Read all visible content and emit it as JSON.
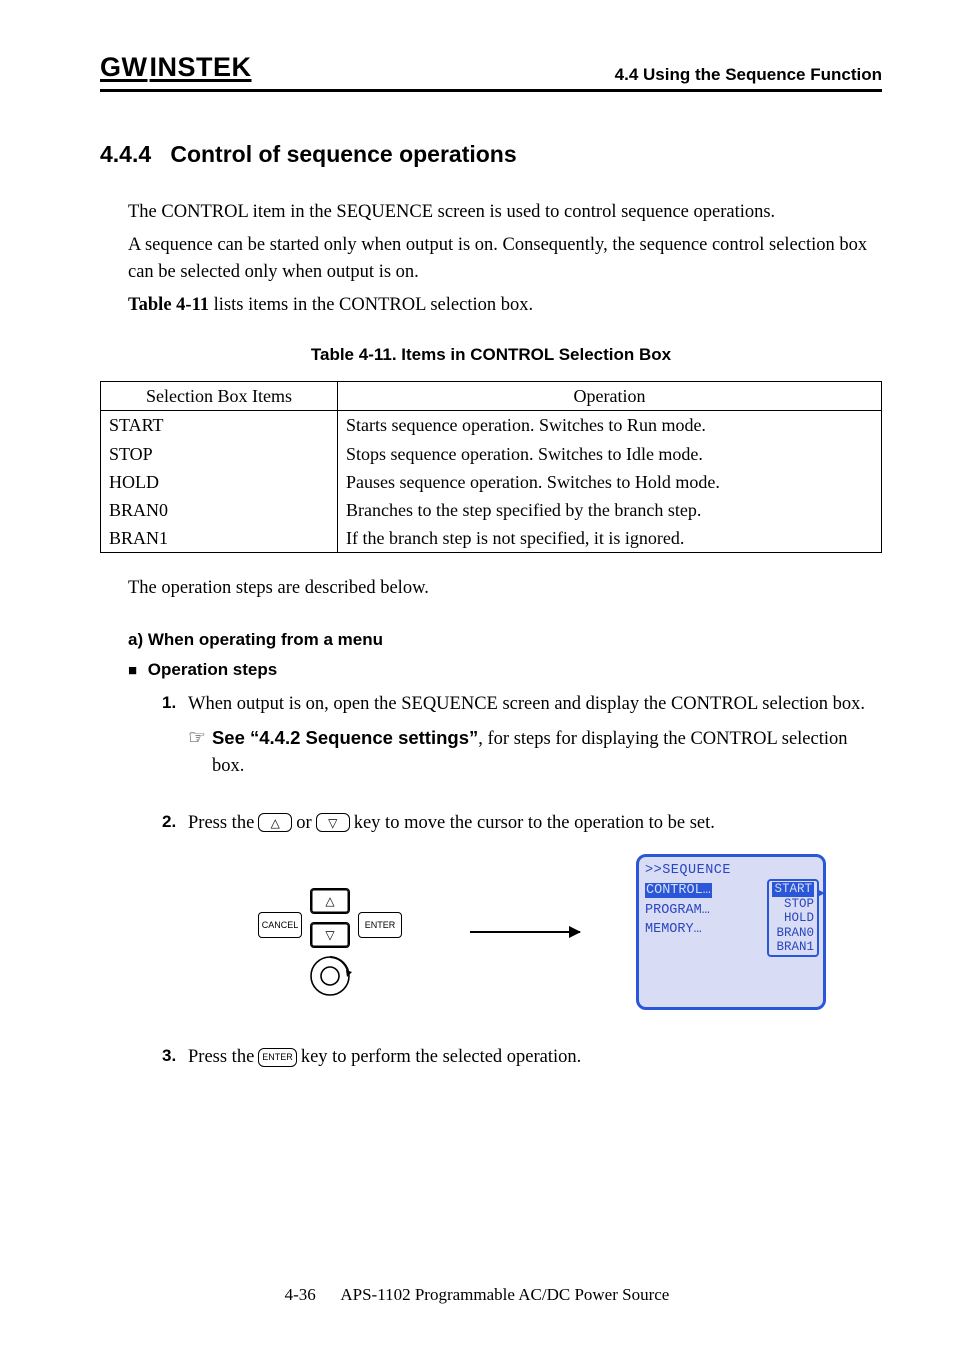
{
  "header": {
    "brand_parts": [
      "G",
      "W",
      "INSTEK"
    ],
    "section_label": "4.4 Using the Sequence Function"
  },
  "title": {
    "number": "4.4.4",
    "text": "Control of sequence operations"
  },
  "intro": {
    "p1": "The CONTROL item in the SEQUENCE screen is used to control sequence operations.",
    "p2": "A sequence can be started only when output is on.  Consequently, the sequence control selection box can be selected only when output is on.",
    "p3_prefix": "Table 4-11",
    "p3_rest": " lists items in the CONTROL selection box."
  },
  "table": {
    "caption": "Table 4-11.  Items in CONTROL Selection Box",
    "head": [
      "Selection Box Items",
      "Operation"
    ],
    "rows": [
      [
        "START",
        "Starts sequence operation.  Switches to Run mode."
      ],
      [
        "STOP",
        "Stops sequence operation.  Switches to Idle mode."
      ],
      [
        "HOLD",
        "Pauses sequence operation.  Switches to Hold mode."
      ],
      [
        "BRAN0",
        "Branches to the step specified by the branch step."
      ],
      [
        "BRAN1",
        "If the branch step is not specified, it is ignored."
      ]
    ]
  },
  "after_table": "The operation steps are described below.",
  "sub_a": "a)  When operating from a menu",
  "op_steps_label": "Operation steps",
  "steps": {
    "s1": {
      "num": "1.",
      "text": "When output is on, open the SEQUENCE screen and display the CONTROL selection box.",
      "see_bold": "See “4.4.2  Sequence settings”",
      "see_rest": ", for steps for displaying the CONTROL selection box."
    },
    "s2": {
      "num": "2.",
      "lead": "Press the ",
      "or": " or ",
      "tail": " key to move the cursor to the operation to be set.",
      "key_up": "△",
      "key_dn": "▽"
    },
    "s3": {
      "num": "3.",
      "lead": "Press the ",
      "tail": " key to perform the selected operation.",
      "key_enter": "ENTER"
    }
  },
  "keypad": {
    "cancel": "CANCEL",
    "enter": "ENTER",
    "up": "△",
    "dn": "▽"
  },
  "lcd": {
    "title": ">>SEQUENCE",
    "left": [
      "CONTROL…",
      "PROGRAM…",
      "MEMORY…"
    ],
    "menu": [
      "START",
      "STOP",
      "HOLD",
      "BRAN0",
      "BRAN1"
    ]
  },
  "footer": {
    "page": "4-36",
    "doc": "APS-1102 Programmable AC/DC Power Source"
  }
}
